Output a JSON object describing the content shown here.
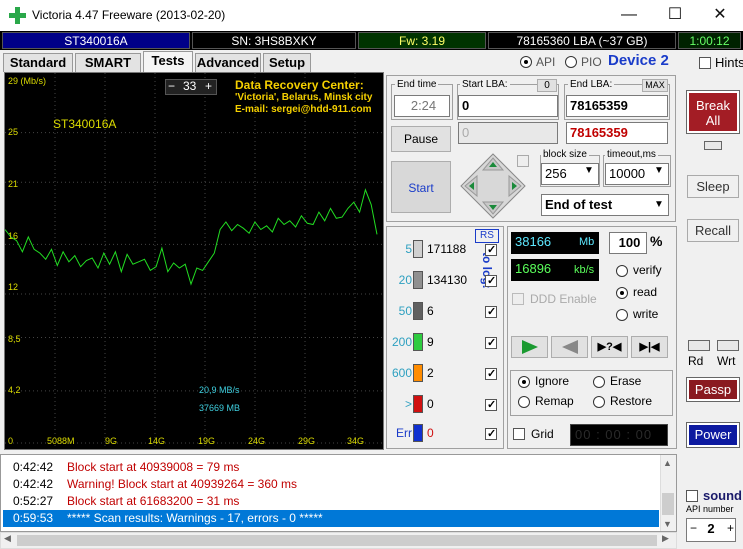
{
  "window": {
    "title": "Victoria 4.47  Freeware (2013-02-20)",
    "min": "—",
    "max": "☐",
    "close": "✕"
  },
  "infobar": {
    "model": "ST340016A",
    "serial": "SN: 3HS8BXKY",
    "firmware": "Fw: 3.19",
    "lba": "78165360 LBA (~37 GB)",
    "time": "1:00:12"
  },
  "tabs": [
    "Standard",
    "SMART",
    "Tests",
    "Advanced",
    "Setup"
  ],
  "mode": {
    "api": "API",
    "pio": "PIO",
    "device": "Device 2",
    "hints": "Hints"
  },
  "graph": {
    "title_line1": "Data Recovery Center:",
    "title_line2": "'Victoria', Belarus, Minsk city",
    "title_line3": "E-mail: sergei@hdd-911.com",
    "counter": "33",
    "minus": "−",
    "plus": "+",
    "drive": "ST340016A",
    "yunit": "29 (Mb/s)",
    "yticks": [
      "25",
      "21",
      "16",
      "12",
      "8,5",
      "4,2",
      "0"
    ],
    "xticks": [
      "5088M",
      "9G",
      "14G",
      "19G",
      "24G",
      "29G",
      "34G"
    ],
    "speed": "20,9 MB/s",
    "position": "37669 MB",
    "trace_color": "#22dd22",
    "trace": [
      17.2,
      16.6,
      16.3,
      15.4,
      16.6,
      15.6,
      15.3,
      14.8,
      15.6,
      14.3,
      15.4,
      14.6,
      15.1,
      14.2,
      14.7,
      14.9,
      14.1,
      15.3,
      14.4,
      15.4,
      13.8,
      15.2,
      14.4,
      14.6,
      14.8,
      13.9,
      14.2,
      15.7,
      13.8,
      14.5,
      14.1,
      14.4,
      12.8,
      14.1,
      13.9,
      14.6,
      15.3,
      17.2,
      17.8,
      17.1,
      17.6,
      17.3,
      16.9,
      17.8,
      17.2,
      17.5,
      17.0,
      18.1,
      17.6,
      17.9,
      17.4,
      18.3,
      17.7,
      17.6,
      18.6,
      17.9,
      18.9,
      18.1,
      18.2,
      18.9,
      19.4,
      18.6,
      20.4,
      19.2,
      16.8
    ]
  },
  "endtime": {
    "label": "End time",
    "value": "2:24"
  },
  "start_lba": {
    "label": "Start LBA:",
    "zero": "0",
    "value": "0",
    "value2": "0"
  },
  "end_lba": {
    "label": "End LBA:",
    "max": "MAX",
    "value": "78165359",
    "value2": "78165359"
  },
  "buttons": {
    "pause": "Pause",
    "start": "Start"
  },
  "block_size": {
    "label": "block size",
    "value": "256"
  },
  "timeout": {
    "label": "timeout,ms",
    "value": "10000"
  },
  "end_action": "End of test",
  "legend": {
    "rs": "RS",
    "to_log": "to log:",
    "rows": [
      {
        "ms": "5",
        "count": "171188",
        "color": "#d0d0d0"
      },
      {
        "ms": "20",
        "count": "134130",
        "color": "#909090"
      },
      {
        "ms": "50",
        "count": "6",
        "color": "#606060"
      },
      {
        "ms": "200",
        "count": "9",
        "color": "#2ecc40"
      },
      {
        "ms": "600",
        "count": "2",
        "color": "#ff8c00"
      },
      {
        "ms": ">",
        "count": "0",
        "color": "#d01010"
      },
      {
        "ms": "Err",
        "count": "0",
        "color": "#1030d0"
      }
    ]
  },
  "stats": {
    "mb": "38166",
    "mb_unit": "Mb",
    "pct": "100",
    "pct_unit": "%",
    "speed": "16896",
    "speed_unit": "kb/s"
  },
  "ddd": "DDD Enable",
  "mode_opts": [
    "verify",
    "read",
    "write"
  ],
  "action_opts": [
    "Ignore",
    "Erase",
    "Remap",
    "Restore"
  ],
  "grid": {
    "label": "Grid",
    "timer": "00 : 00 : 00"
  },
  "side": {
    "break": "Break All",
    "sleep": "Sleep",
    "recall": "Recall",
    "rd": "Rd",
    "wrt": "Wrt",
    "passp": "Passp",
    "power": "Power",
    "sound": "sound",
    "api_number": "API number",
    "api_value": "2"
  },
  "log": [
    {
      "time": "0:42:42",
      "text": "Block start at 40939008 = 79 ms",
      "color": "#c00000"
    },
    {
      "time": "0:42:42",
      "text": "Warning! Block start at 40939264 = 360 ms",
      "color": "#c00000"
    },
    {
      "time": "0:52:27",
      "text": "Block start at 61683200 = 31 ms",
      "color": "#c00000"
    },
    {
      "time": "0:59:53",
      "text": "***** Scan results: Warnings - 17, errors - 0 *****",
      "color": "#ffffff"
    }
  ]
}
